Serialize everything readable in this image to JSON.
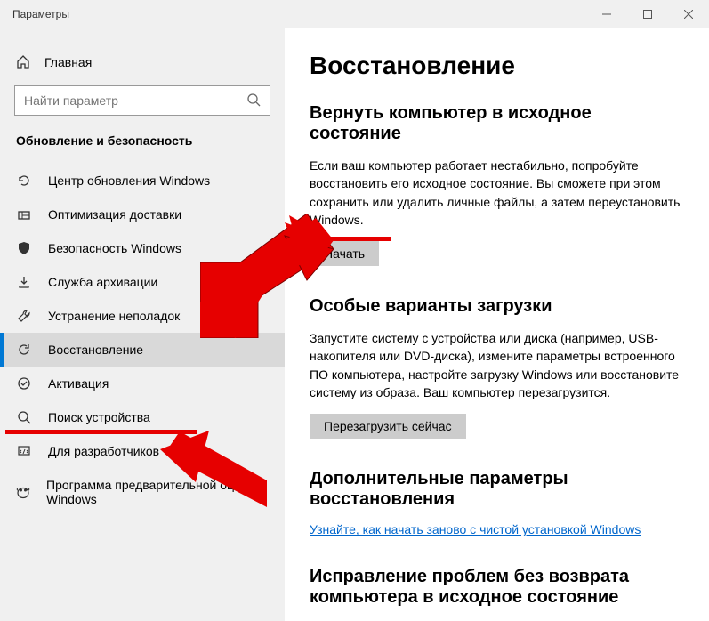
{
  "window": {
    "title": "Параметры"
  },
  "sidebar": {
    "home": "Главная",
    "search_placeholder": "Найти параметр",
    "section": "Обновление и безопасность",
    "items": [
      {
        "label": "Центр обновления Windows"
      },
      {
        "label": "Оптимизация доставки"
      },
      {
        "label": "Безопасность Windows"
      },
      {
        "label": "Служба архивации"
      },
      {
        "label": "Устранение неполадок"
      },
      {
        "label": "Восстановление"
      },
      {
        "label": "Активация"
      },
      {
        "label": "Поиск устройства"
      },
      {
        "label": "Для разработчиков"
      },
      {
        "label": "Программа предварительной оценки Windows"
      }
    ]
  },
  "main": {
    "heading": "Восстановление",
    "s1": {
      "title": "Вернуть компьютер в исходное состояние",
      "body": "Если ваш компьютер работает нестабильно, попробуйте восстановить его исходное состояние. Вы сможете при этом сохранить или удалить личные файлы, а затем переустановить Windows.",
      "btn": "Начать"
    },
    "s2": {
      "title": "Особые варианты загрузки",
      "body": "Запустите систему с устройства или диска (например, USB-накопителя или DVD-диска), измените параметры встроенного ПО компьютера, настройте загрузку Windows или восстановите систему из образа. Ваш компьютер перезагрузится.",
      "btn": "Перезагрузить сейчас"
    },
    "s3": {
      "title": "Дополнительные параметры восстановления",
      "link": "Узнайте, как начать заново с чистой установкой Windows"
    },
    "s4": {
      "title": "Исправление проблем без возврата компьютера в исходное состояние"
    }
  }
}
